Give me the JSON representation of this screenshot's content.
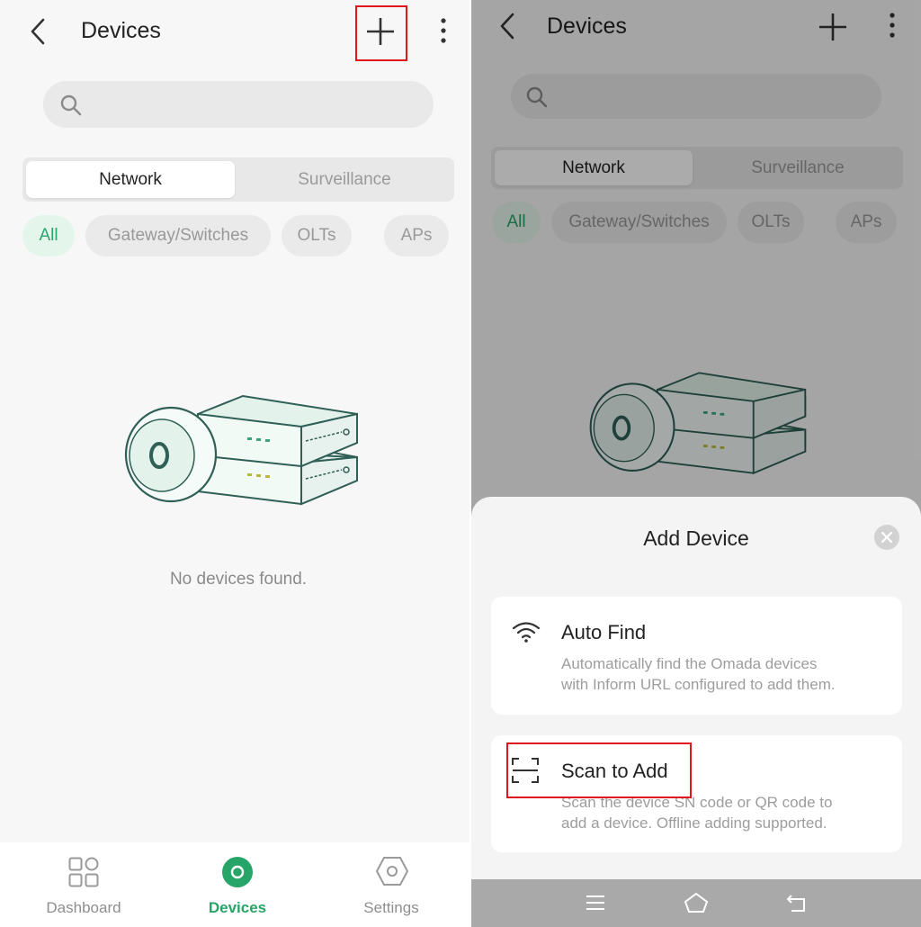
{
  "left": {
    "header": {
      "title": "Devices"
    },
    "tabs": [
      {
        "label": "Network",
        "active": true
      },
      {
        "label": "Surveillance",
        "active": false
      }
    ],
    "chips": [
      {
        "label": "All",
        "active": true
      },
      {
        "label": "Gateway/Switches",
        "active": false
      },
      {
        "label": "OLTs",
        "active": false
      },
      {
        "label": "APs",
        "active": false
      }
    ],
    "empty_message": "No devices found.",
    "bottom_nav": [
      {
        "label": "Dashboard",
        "icon": "grid-icon",
        "active": false
      },
      {
        "label": "Devices",
        "icon": "devices-icon",
        "active": true
      },
      {
        "label": "Settings",
        "icon": "hexagon-gear-icon",
        "active": false
      }
    ]
  },
  "right": {
    "header": {
      "title": "Devices"
    },
    "tabs": [
      {
        "label": "Network",
        "active": true
      },
      {
        "label": "Surveillance",
        "active": false
      }
    ],
    "chips": [
      {
        "label": "All",
        "active": true
      },
      {
        "label": "Gateway/Switches",
        "active": false
      },
      {
        "label": "OLTs",
        "active": false
      },
      {
        "label": "APs",
        "active": false
      }
    ],
    "sheet": {
      "title": "Add Device",
      "options": [
        {
          "title": "Auto Find",
          "icon": "wifi-icon",
          "desc_line1": "Automatically find the Omada devices",
          "desc_line2": "with Inform URL configured to add them."
        },
        {
          "title": "Scan to Add",
          "icon": "scan-icon",
          "desc_line1": "Scan the device SN code or QR code to",
          "desc_line2": "add a device. Offline adding supported."
        }
      ]
    },
    "system_nav": [
      "menu-icon",
      "home-icon",
      "back-arrow-icon"
    ]
  },
  "colors": {
    "accent": "#27a568",
    "highlight": "#e0161b"
  }
}
